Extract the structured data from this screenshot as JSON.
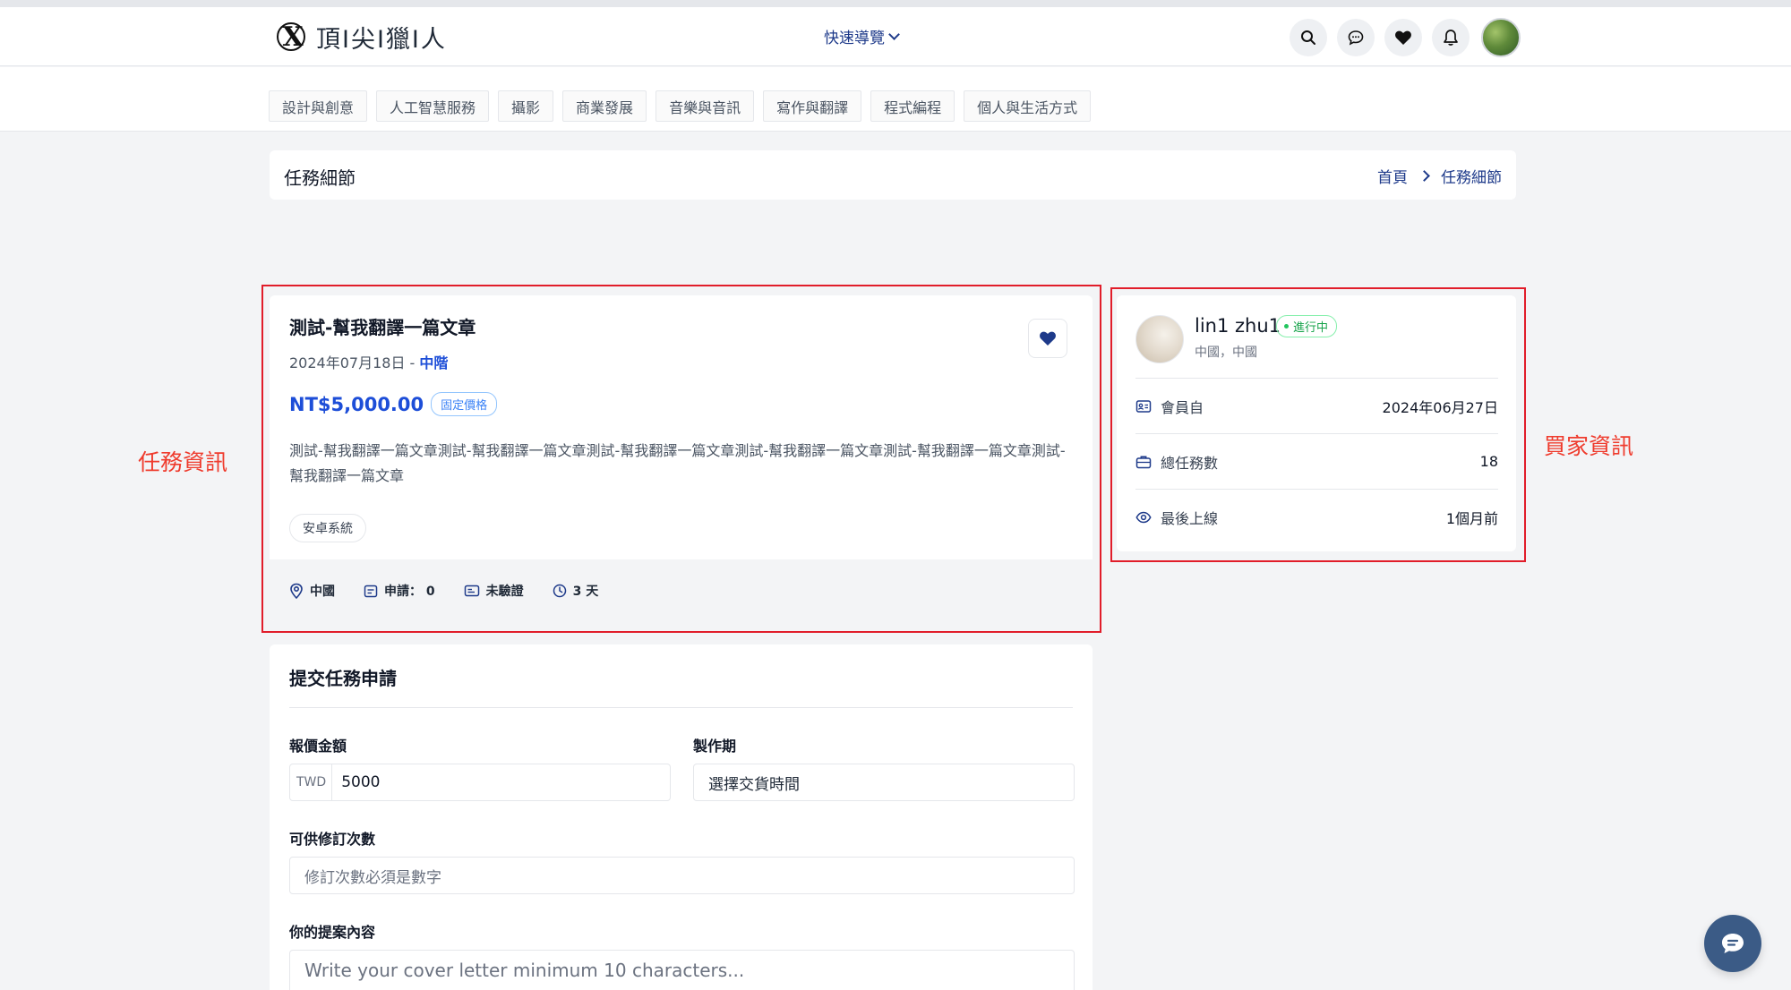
{
  "header": {
    "logo_text": "頂I尖I獵I人",
    "quick_nav_label": "快速導覽",
    "icons": [
      "search-icon",
      "chat-icon",
      "heart-icon",
      "bell-icon"
    ]
  },
  "categories": [
    "設計與創意",
    "人工智慧服務",
    "攝影",
    "商業發展",
    "音樂與音訊",
    "寫作與翻譯",
    "程式編程",
    "個人與生活方式"
  ],
  "page": {
    "title": "任務細節",
    "breadcrumb_home": "首頁",
    "breadcrumb_current": "任務細節"
  },
  "annotations": {
    "task_info": "任務資訊",
    "buyer_info": "買家資訊"
  },
  "task": {
    "title": "測試-幫我翻譯一篇文章",
    "date": "2024年07月18日 -",
    "level": "中階",
    "price": "NT$5,000.00",
    "price_type": "固定價格",
    "description": "測試-幫我翻譯一篇文章測試-幫我翻譯一篇文章測試-幫我翻譯一篇文章測試-幫我翻譯一篇文章測試-幫我翻譯一篇文章測試-幫我翻譯一篇文章",
    "tag": "安卓系統",
    "location": "中國",
    "applications": "申請： 0",
    "verification": "未驗證",
    "duration": "3 天"
  },
  "buyer": {
    "name": "lin1 zhu1",
    "status": "進行中",
    "location": "中國，中國",
    "member_since_label": "會員自",
    "member_since": "2024年06月27日",
    "total_tasks_label": "總任務數",
    "total_tasks": "18",
    "last_online_label": "最後上線",
    "last_online": "1個月前"
  },
  "application_form": {
    "title": "提交任務申請",
    "quote_label": "報價金額",
    "currency": "TWD",
    "quote_value": "5000",
    "delivery_label": "製作期",
    "delivery_placeholder": "選擇交貨時間",
    "revisions_label": "可供修訂次數",
    "revisions_placeholder": "修訂次數必須是數字",
    "proposal_label": "你的提案內容",
    "proposal_placeholder": "Write your cover letter minimum 10 characters..."
  },
  "colors": {
    "annotation_red": "#e11d2a",
    "primary_blue": "#1d4ed8",
    "nav_blue": "#1e3a8a",
    "success_green": "#16a34a"
  }
}
